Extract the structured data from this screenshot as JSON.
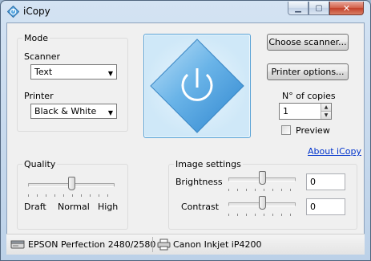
{
  "window": {
    "title": "iCopy",
    "icon": "icopy-app-icon",
    "caption_buttons": [
      "minimize",
      "maximize",
      "close"
    ]
  },
  "mode": {
    "group_label": "Mode",
    "scanner_label": "Scanner",
    "scanner_value": "Text",
    "printer_label": "Printer",
    "printer_value": "Black & White"
  },
  "preview": {
    "icon": "power-icon",
    "accent": "#4a9fdc"
  },
  "actions": {
    "choose_scanner": "Choose scanner...",
    "printer_options": "Printer options..."
  },
  "copies": {
    "label": "N° of copies",
    "value": "1",
    "preview_label": "Preview",
    "preview_checked": false
  },
  "about_link": "About iCopy",
  "quality": {
    "group_label": "Quality",
    "ticks": [
      "Draft",
      "Normal",
      "High"
    ],
    "level": 0.5
  },
  "image_settings": {
    "group_label": "Image settings",
    "brightness_label": "Brightness",
    "brightness_value": "0",
    "brightness_level": 0.5,
    "contrast_label": "Contrast",
    "contrast_value": "0",
    "contrast_level": 0.5
  },
  "status": {
    "scanner": "EPSON Perfection 2480/2580",
    "printer": "Canon Inkjet iP4200"
  },
  "colors": {
    "link": "#0033cc",
    "title_bar": "#c7d9ee",
    "close_button": "#c4412a"
  }
}
